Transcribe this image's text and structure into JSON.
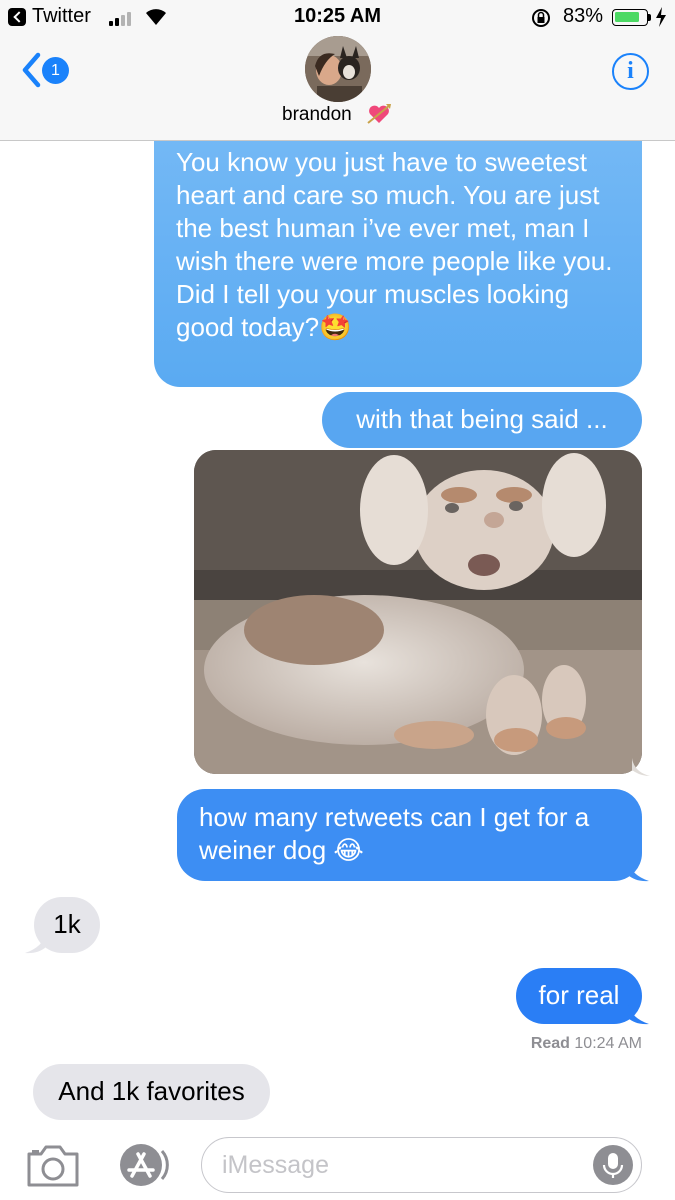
{
  "status_bar": {
    "back_app": "Twitter",
    "time": "10:25 AM",
    "battery_percent_label": "83%",
    "battery_level": 0.83
  },
  "header": {
    "unread_count": "1",
    "contact_name": "brandon",
    "name_emoji": "💘",
    "info_label": "i"
  },
  "messages": [
    {
      "from": "me",
      "text": "You know you just have to sweetest heart and care so much. You are just the best human i’ve ever met, man I wish there were more people like you. Did I tell you your muscles looking good today?🤩"
    },
    {
      "from": "me",
      "text": "with that being said ..."
    },
    {
      "from": "me",
      "type": "image",
      "subject": "dachshund puppy photo"
    },
    {
      "from": "me",
      "text": "how many retweets can I get for a weiner dog 😂"
    },
    {
      "from": "them",
      "text": "1k"
    },
    {
      "from": "me",
      "text": "for real"
    },
    {
      "from": "them",
      "text": "And 1k favorites"
    }
  ],
  "read_receipt": {
    "label": "Read",
    "time": "10:24 AM"
  },
  "input_bar": {
    "placeholder": "iMessage"
  },
  "colors": {
    "ios_blue": "#1a82fb",
    "received_bubble": "#e5e5ea",
    "battery_green": "#4cd964"
  }
}
